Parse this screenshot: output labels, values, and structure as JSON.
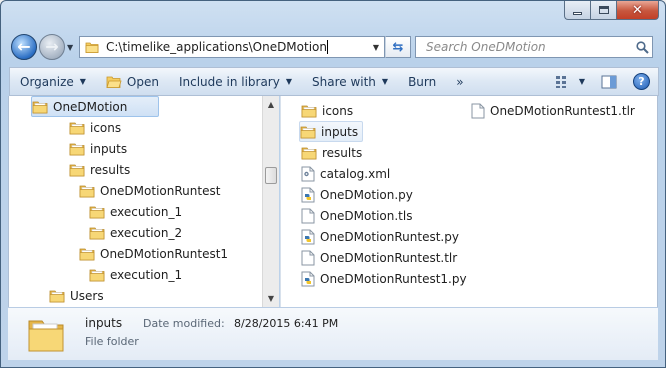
{
  "navigation": {
    "address_path": "C:\\timelike_applications\\OneDMotion",
    "search_placeholder": "Search OneDMotion"
  },
  "toolbar": {
    "organize": "Organize",
    "open": "Open",
    "include_in_library": "Include in library",
    "share_with": "Share with",
    "burn": "Burn",
    "more": "»"
  },
  "tree": {
    "items": [
      {
        "label": "OneDMotion",
        "level": 1,
        "selected": true
      },
      {
        "label": "icons",
        "level": 2
      },
      {
        "label": "inputs",
        "level": 2
      },
      {
        "label": "results",
        "level": 2
      },
      {
        "label": "OneDMotionRuntest",
        "level": 3
      },
      {
        "label": "execution_1",
        "level": 4
      },
      {
        "label": "execution_2",
        "level": 4
      },
      {
        "label": "OneDMotionRuntest1",
        "level": 3
      },
      {
        "label": "execution_1",
        "level": 4
      },
      {
        "label": "Users",
        "level": 0
      }
    ]
  },
  "files": {
    "items": [
      {
        "name": "icons",
        "type": "folder"
      },
      {
        "name": "inputs",
        "type": "folder",
        "selected": true
      },
      {
        "name": "results",
        "type": "folder"
      },
      {
        "name": "catalog.xml",
        "type": "xml"
      },
      {
        "name": "OneDMotion.py",
        "type": "python"
      },
      {
        "name": "OneDMotion.tls",
        "type": "document"
      },
      {
        "name": "OneDMotionRuntest.py",
        "type": "python"
      },
      {
        "name": "OneDMotionRuntest.tlr",
        "type": "document"
      },
      {
        "name": "OneDMotionRuntest1.py",
        "type": "python"
      },
      {
        "name": "OneDMotionRuntest1.tlr",
        "type": "document"
      }
    ]
  },
  "details": {
    "name": "inputs",
    "modified_label": "Date modified:",
    "modified_value": "8/28/2015 6:41 PM",
    "type": "File folder"
  },
  "colors": {
    "folder": "#e8b94a",
    "accent": "#1d5cb5",
    "selection": "#cfe1f5"
  }
}
